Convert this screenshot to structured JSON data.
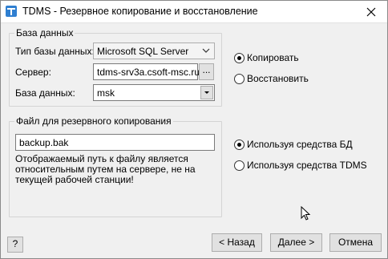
{
  "window": {
    "title": "TDMS - Резервное копирование и восстановление",
    "icon": "tdms-app-icon",
    "close_icon": "close-icon"
  },
  "database_group": {
    "legend": "База данных",
    "db_type_label": "Тип базы данных:",
    "db_type_value": "Microsoft SQL Server",
    "server_label": "Сервер:",
    "server_value": "tdms-srv3a.csoft-msc.ru",
    "browse_label": "...",
    "database_label": "База данных:",
    "database_value": "msk"
  },
  "mode": {
    "backup_label": "Копировать",
    "backup_selected": true,
    "restore_label": "Восстановить",
    "restore_selected": false
  },
  "file_group": {
    "legend": "Файл для резервного копирования",
    "file_value": "backup.bak",
    "note": "Отображаемый путь к файлу является\nотносительным путем на сервере, не на\nтекущей рабочей станции!"
  },
  "method": {
    "db_tools_label": "Используя средства БД",
    "db_tools_selected": true,
    "tdms_tools_label": "Используя средства TDMS",
    "tdms_tools_selected": false
  },
  "footer": {
    "help_label": "?",
    "back_label": "< Назад",
    "next_label": "Далее >",
    "cancel_label": "Отмена"
  }
}
